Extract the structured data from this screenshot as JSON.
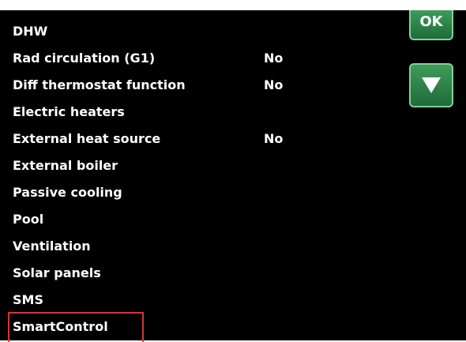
{
  "menu": {
    "items": [
      {
        "label": "DHW",
        "value": ""
      },
      {
        "label": "Rad circulation (G1)",
        "value": "No"
      },
      {
        "label": "Diff thermostat function",
        "value": "No"
      },
      {
        "label": "Electric heaters",
        "value": ""
      },
      {
        "label": "External heat source",
        "value": "No"
      },
      {
        "label": "External boiler",
        "value": ""
      },
      {
        "label": "Passive cooling",
        "value": ""
      },
      {
        "label": "Pool",
        "value": ""
      },
      {
        "label": "Ventilation",
        "value": ""
      },
      {
        "label": "Solar panels",
        "value": ""
      },
      {
        "label": "SMS",
        "value": ""
      },
      {
        "label": "SmartControl",
        "value": ""
      }
    ],
    "selected_index": 11
  },
  "buttons": {
    "ok_label": "OK",
    "down_icon": "arrow-down-icon"
  },
  "colors": {
    "background": "#000000",
    "text": "#ffffff",
    "button_green": "#2f8a4c",
    "selection_highlight": "#d23636"
  }
}
